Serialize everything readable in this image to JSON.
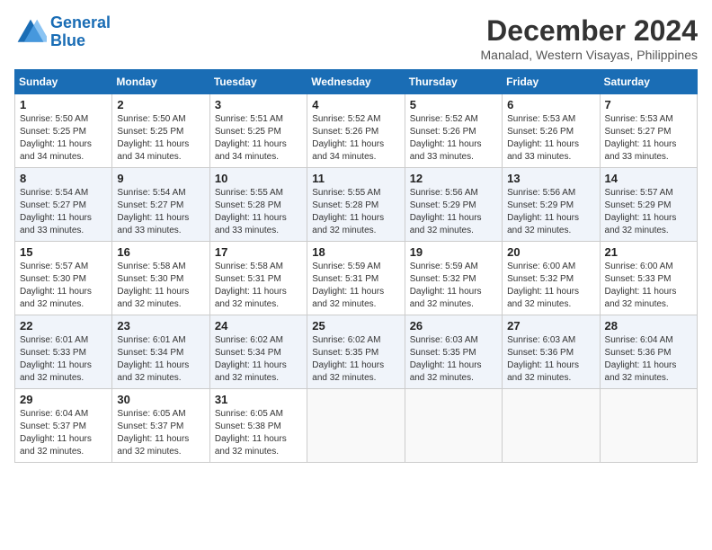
{
  "logo": {
    "line1": "General",
    "line2": "Blue"
  },
  "title": "December 2024",
  "location": "Manalad, Western Visayas, Philippines",
  "weekdays": [
    "Sunday",
    "Monday",
    "Tuesday",
    "Wednesday",
    "Thursday",
    "Friday",
    "Saturday"
  ],
  "weeks": [
    [
      {
        "day": 1,
        "sunrise": "5:50 AM",
        "sunset": "5:25 PM",
        "daylight": "11 hours and 34 minutes."
      },
      {
        "day": 2,
        "sunrise": "5:50 AM",
        "sunset": "5:25 PM",
        "daylight": "11 hours and 34 minutes."
      },
      {
        "day": 3,
        "sunrise": "5:51 AM",
        "sunset": "5:25 PM",
        "daylight": "11 hours and 34 minutes."
      },
      {
        "day": 4,
        "sunrise": "5:52 AM",
        "sunset": "5:26 PM",
        "daylight": "11 hours and 34 minutes."
      },
      {
        "day": 5,
        "sunrise": "5:52 AM",
        "sunset": "5:26 PM",
        "daylight": "11 hours and 33 minutes."
      },
      {
        "day": 6,
        "sunrise": "5:53 AM",
        "sunset": "5:26 PM",
        "daylight": "11 hours and 33 minutes."
      },
      {
        "day": 7,
        "sunrise": "5:53 AM",
        "sunset": "5:27 PM",
        "daylight": "11 hours and 33 minutes."
      }
    ],
    [
      {
        "day": 8,
        "sunrise": "5:54 AM",
        "sunset": "5:27 PM",
        "daylight": "11 hours and 33 minutes."
      },
      {
        "day": 9,
        "sunrise": "5:54 AM",
        "sunset": "5:27 PM",
        "daylight": "11 hours and 33 minutes."
      },
      {
        "day": 10,
        "sunrise": "5:55 AM",
        "sunset": "5:28 PM",
        "daylight": "11 hours and 33 minutes."
      },
      {
        "day": 11,
        "sunrise": "5:55 AM",
        "sunset": "5:28 PM",
        "daylight": "11 hours and 32 minutes."
      },
      {
        "day": 12,
        "sunrise": "5:56 AM",
        "sunset": "5:29 PM",
        "daylight": "11 hours and 32 minutes."
      },
      {
        "day": 13,
        "sunrise": "5:56 AM",
        "sunset": "5:29 PM",
        "daylight": "11 hours and 32 minutes."
      },
      {
        "day": 14,
        "sunrise": "5:57 AM",
        "sunset": "5:29 PM",
        "daylight": "11 hours and 32 minutes."
      }
    ],
    [
      {
        "day": 15,
        "sunrise": "5:57 AM",
        "sunset": "5:30 PM",
        "daylight": "11 hours and 32 minutes."
      },
      {
        "day": 16,
        "sunrise": "5:58 AM",
        "sunset": "5:30 PM",
        "daylight": "11 hours and 32 minutes."
      },
      {
        "day": 17,
        "sunrise": "5:58 AM",
        "sunset": "5:31 PM",
        "daylight": "11 hours and 32 minutes."
      },
      {
        "day": 18,
        "sunrise": "5:59 AM",
        "sunset": "5:31 PM",
        "daylight": "11 hours and 32 minutes."
      },
      {
        "day": 19,
        "sunrise": "5:59 AM",
        "sunset": "5:32 PM",
        "daylight": "11 hours and 32 minutes."
      },
      {
        "day": 20,
        "sunrise": "6:00 AM",
        "sunset": "5:32 PM",
        "daylight": "11 hours and 32 minutes."
      },
      {
        "day": 21,
        "sunrise": "6:00 AM",
        "sunset": "5:33 PM",
        "daylight": "11 hours and 32 minutes."
      }
    ],
    [
      {
        "day": 22,
        "sunrise": "6:01 AM",
        "sunset": "5:33 PM",
        "daylight": "11 hours and 32 minutes."
      },
      {
        "day": 23,
        "sunrise": "6:01 AM",
        "sunset": "5:34 PM",
        "daylight": "11 hours and 32 minutes."
      },
      {
        "day": 24,
        "sunrise": "6:02 AM",
        "sunset": "5:34 PM",
        "daylight": "11 hours and 32 minutes."
      },
      {
        "day": 25,
        "sunrise": "6:02 AM",
        "sunset": "5:35 PM",
        "daylight": "11 hours and 32 minutes."
      },
      {
        "day": 26,
        "sunrise": "6:03 AM",
        "sunset": "5:35 PM",
        "daylight": "11 hours and 32 minutes."
      },
      {
        "day": 27,
        "sunrise": "6:03 AM",
        "sunset": "5:36 PM",
        "daylight": "11 hours and 32 minutes."
      },
      {
        "day": 28,
        "sunrise": "6:04 AM",
        "sunset": "5:36 PM",
        "daylight": "11 hours and 32 minutes."
      }
    ],
    [
      {
        "day": 29,
        "sunrise": "6:04 AM",
        "sunset": "5:37 PM",
        "daylight": "11 hours and 32 minutes."
      },
      {
        "day": 30,
        "sunrise": "6:05 AM",
        "sunset": "5:37 PM",
        "daylight": "11 hours and 32 minutes."
      },
      {
        "day": 31,
        "sunrise": "6:05 AM",
        "sunset": "5:38 PM",
        "daylight": "11 hours and 32 minutes."
      },
      null,
      null,
      null,
      null
    ]
  ]
}
